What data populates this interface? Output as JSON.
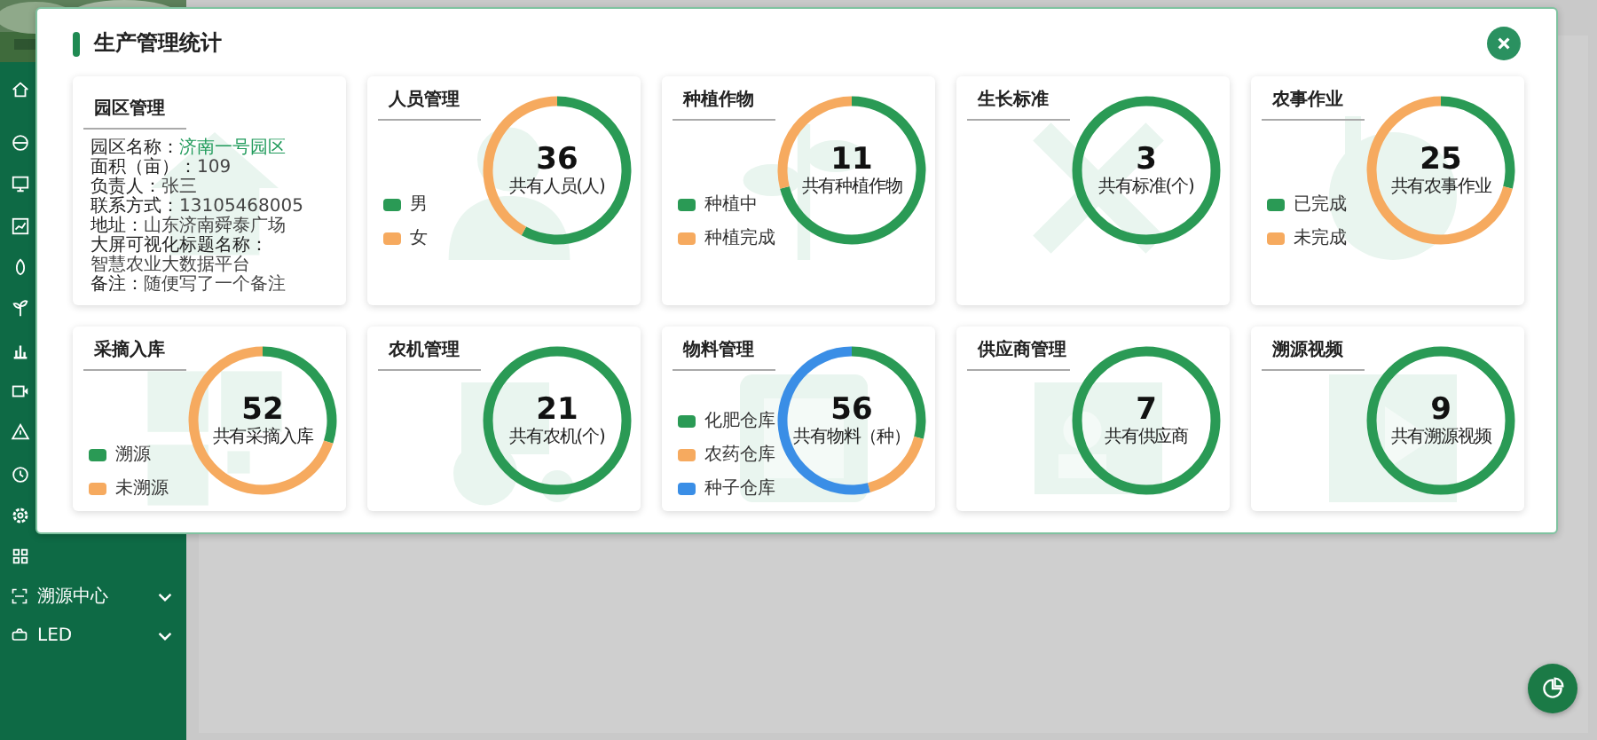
{
  "sidebar": {
    "menu": [
      {
        "label": "溯源中心"
      },
      {
        "label": "LED"
      }
    ]
  },
  "modal": {
    "title": "生产管理统计",
    "cards": [
      {
        "kind": "info",
        "title": "园区管理",
        "fields": [
          {
            "label": "园区名称：",
            "value": "济南一号园区",
            "highlight": true
          },
          {
            "label": "面积（亩）：",
            "value": "109",
            "highlight": false
          },
          {
            "label": "负责人：",
            "value": "张三",
            "highlight": false
          },
          {
            "label": "联系方式：",
            "value": "13105468005",
            "highlight": false
          },
          {
            "label": "地址：",
            "value": "山东济南舜泰广场",
            "highlight": false
          },
          {
            "label": "大屏可视化标题名称：",
            "value": "智慧农业大数据平台",
            "highlight": false
          },
          {
            "label": "备注：",
            "value": "随便写了一个备注",
            "highlight": false
          }
        ]
      },
      {
        "kind": "donut",
        "title": "人员管理",
        "total": "36",
        "caption": "共有人员(人)",
        "legend": [
          {
            "label": "男",
            "color": "#2a9a55"
          },
          {
            "label": "女",
            "color": "#f6aa5f"
          }
        ],
        "chart_data": {
          "type": "donut",
          "values": [
            58,
            42
          ]
        }
      },
      {
        "kind": "donut",
        "title": "种植作物",
        "total": "11",
        "caption": "共有种植作物",
        "legend": [
          {
            "label": "种植中",
            "color": "#2a9a55"
          },
          {
            "label": "种植完成",
            "color": "#f6aa5f"
          }
        ],
        "chart_data": {
          "type": "donut",
          "values": [
            71,
            29
          ]
        }
      },
      {
        "kind": "donut",
        "title": "生长标准",
        "total": "3",
        "caption": "共有标准(个)"
      },
      {
        "kind": "donut",
        "title": "农事作业",
        "total": "25",
        "caption": "共有农事作业",
        "legend": [
          {
            "label": "已完成",
            "color": "#2a9a55"
          },
          {
            "label": "未完成",
            "color": "#f6aa5f"
          }
        ],
        "chart_data": {
          "type": "donut",
          "values": [
            29,
            71
          ]
        }
      },
      {
        "kind": "donut",
        "title": "采摘入库",
        "total": "52",
        "caption": "共有采摘入库",
        "legend": [
          {
            "label": "溯源",
            "color": "#2a9a55"
          },
          {
            "label": "未溯源",
            "color": "#f6aa5f"
          }
        ],
        "chart_data": {
          "type": "donut",
          "values": [
            30,
            70
          ]
        }
      },
      {
        "kind": "donut",
        "title": "农机管理",
        "total": "21",
        "caption": "共有农机(个)"
      },
      {
        "kind": "donut",
        "title": "物料管理",
        "total": "56",
        "caption": "共有物料（种）",
        "legend": [
          {
            "label": "化肥仓库",
            "color": "#2a9a55"
          },
          {
            "label": "农药仓库",
            "color": "#f6aa5f"
          },
          {
            "label": "种子仓库",
            "color": "#3a8ee6"
          }
        ],
        "chart_data": {
          "type": "donut",
          "values": [
            29,
            17,
            54
          ]
        }
      },
      {
        "kind": "donut",
        "title": "供应商管理",
        "total": "7",
        "caption": "共有供应商"
      },
      {
        "kind": "donut",
        "title": "溯源视频",
        "total": "9",
        "caption": "共有溯源视频"
      }
    ]
  }
}
